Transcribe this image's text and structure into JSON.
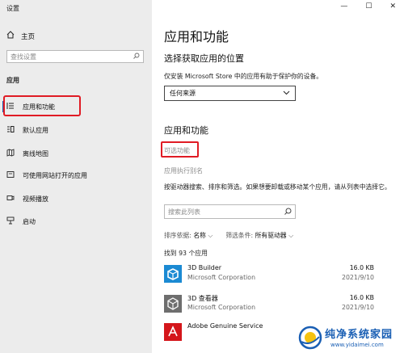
{
  "window": {
    "title": "设置",
    "controls": [
      "—",
      "☐",
      "✕"
    ]
  },
  "sidebar": {
    "home": {
      "label": "主页",
      "icon": "home-icon"
    },
    "search": {
      "placeholder": "查找设置",
      "icon": "search-icon"
    },
    "section": "应用",
    "items": [
      {
        "label": "应用和功能",
        "icon": "apps-features-icon",
        "active": true
      },
      {
        "label": "默认应用",
        "icon": "default-apps-icon"
      },
      {
        "label": "离线地图",
        "icon": "offline-maps-icon"
      },
      {
        "label": "可使用网站打开的应用",
        "icon": "apps-for-websites-icon"
      },
      {
        "label": "视频播放",
        "icon": "video-playback-icon"
      },
      {
        "label": "启动",
        "icon": "startup-icon"
      }
    ]
  },
  "main": {
    "title": "应用和功能",
    "location": {
      "heading": "选择获取应用的位置",
      "description": "仅安装 Microsoft Store 中的应用有助于保护你的设备。",
      "dropdown_value": "任何来源"
    },
    "apps": {
      "heading": "应用和功能",
      "optional_features_link": "可选功能",
      "app_alias_link": "应用执行别名",
      "description": "按驱动器搜索、排序和筛选。如果想要卸载或移动某个应用，请从列表中选择它。",
      "search_placeholder": "搜索此列表",
      "sort_label": "排序依据:",
      "sort_value": "名称",
      "filter_label": "筛选条件:",
      "filter_value": "所有驱动器",
      "count_text": "找到 93 个应用",
      "list": [
        {
          "name": "3D Builder",
          "publisher": "Microsoft Corporation",
          "size": "16.0 KB",
          "date": "2021/9/10",
          "icon": "3d-builder-icon"
        },
        {
          "name": "3D 查看器",
          "publisher": "Microsoft Corporation",
          "size": "16.0 KB",
          "date": "2021/9/10",
          "icon": "3d-viewer-icon"
        },
        {
          "name": "Adobe Genuine Service",
          "publisher": "",
          "size": "",
          "date": "",
          "icon": "adobe-icon"
        }
      ]
    }
  },
  "watermark": {
    "title": "纯净系统家园",
    "url": "www.yidaimei.com"
  }
}
